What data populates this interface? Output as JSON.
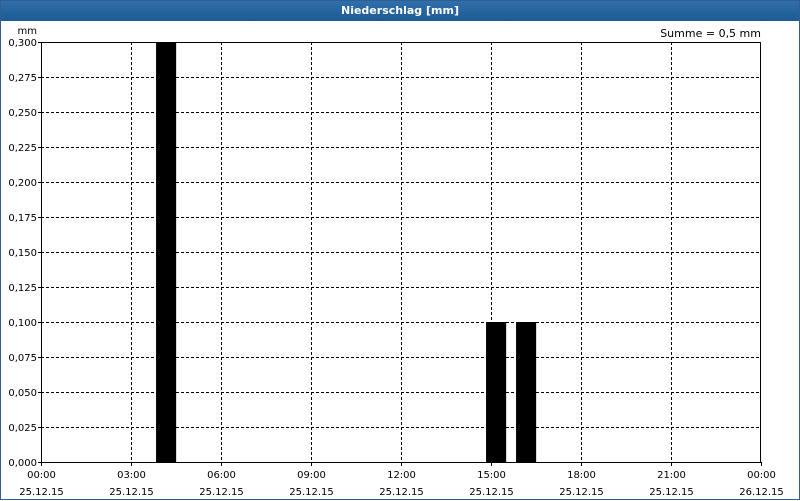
{
  "window": {
    "title": "Niederschlag [mm]"
  },
  "summary": "Summe = 0,5 mm",
  "chart_data": {
    "type": "bar",
    "title": "Niederschlag [mm]",
    "ylabel": "mm",
    "xlabel": "",
    "ylim": [
      0,
      0.3
    ],
    "yticks": [
      0,
      0.025,
      0.05,
      0.075,
      0.1,
      0.125,
      0.15,
      0.175,
      0.2,
      0.225,
      0.25,
      0.275,
      0.3
    ],
    "ytick_labels": [
      "0,000",
      "0,025",
      "0,050",
      "0,075",
      "0,100",
      "0,125",
      "0,150",
      "0,175",
      "0,200",
      "0,225",
      "0,250",
      "0,275",
      "0,300"
    ],
    "xlim_hours": [
      0,
      24
    ],
    "xticks_hours": [
      0,
      3,
      6,
      9,
      12,
      15,
      18,
      21,
      24
    ],
    "xtick_time_labels": [
      "00:00",
      "03:00",
      "06:00",
      "09:00",
      "12:00",
      "15:00",
      "18:00",
      "21:00",
      "00:00"
    ],
    "xtick_date_labels": [
      "25.12.15",
      "25.12.15",
      "25.12.15",
      "25.12.15",
      "25.12.15",
      "25.12.15",
      "25.12.15",
      "25.12.15",
      "26.12.15"
    ],
    "bar_width_hours": 0.67,
    "series": [
      {
        "color": "#000000",
        "points": [
          {
            "x_hours": 4.17,
            "value": 0.3
          },
          {
            "x_hours": 15.17,
            "value": 0.1
          },
          {
            "x_hours": 16.17,
            "value": 0.1
          }
        ]
      }
    ],
    "grid": true,
    "grid_style": "dashed"
  }
}
